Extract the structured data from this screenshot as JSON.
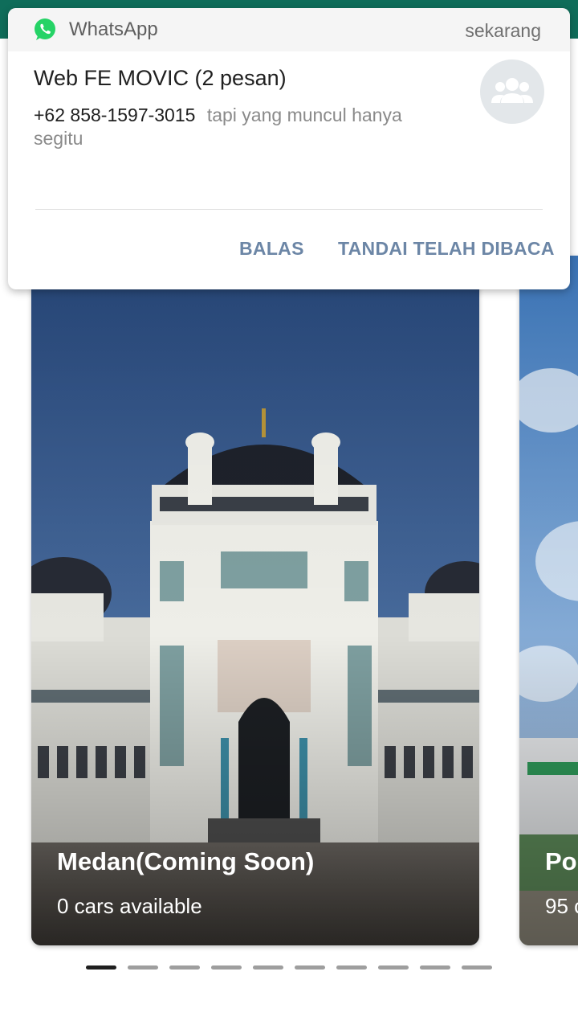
{
  "notification": {
    "app_name": "WhatsApp",
    "time": "sekarang",
    "title": "Web FE MOVIC (2 pesan)",
    "sender": "+62 858-1597-3015",
    "message": "tapi yang muncul hanya segitu",
    "actions": {
      "reply": "BALAS",
      "mark_read": "TANDAI TELAH DIBACA"
    },
    "colors": {
      "whatsapp_green": "#25D366",
      "action_text": "#6C86A6"
    }
  },
  "carousel": {
    "cards": [
      {
        "title": "Medan(Coming Soon)",
        "subtitle": "0 cars available"
      },
      {
        "title": "Po",
        "subtitle": "95 c"
      }
    ],
    "pager": {
      "total": 10,
      "active_index": 0
    }
  },
  "icons": {
    "app": "whatsapp-icon",
    "avatar": "group-icon"
  }
}
